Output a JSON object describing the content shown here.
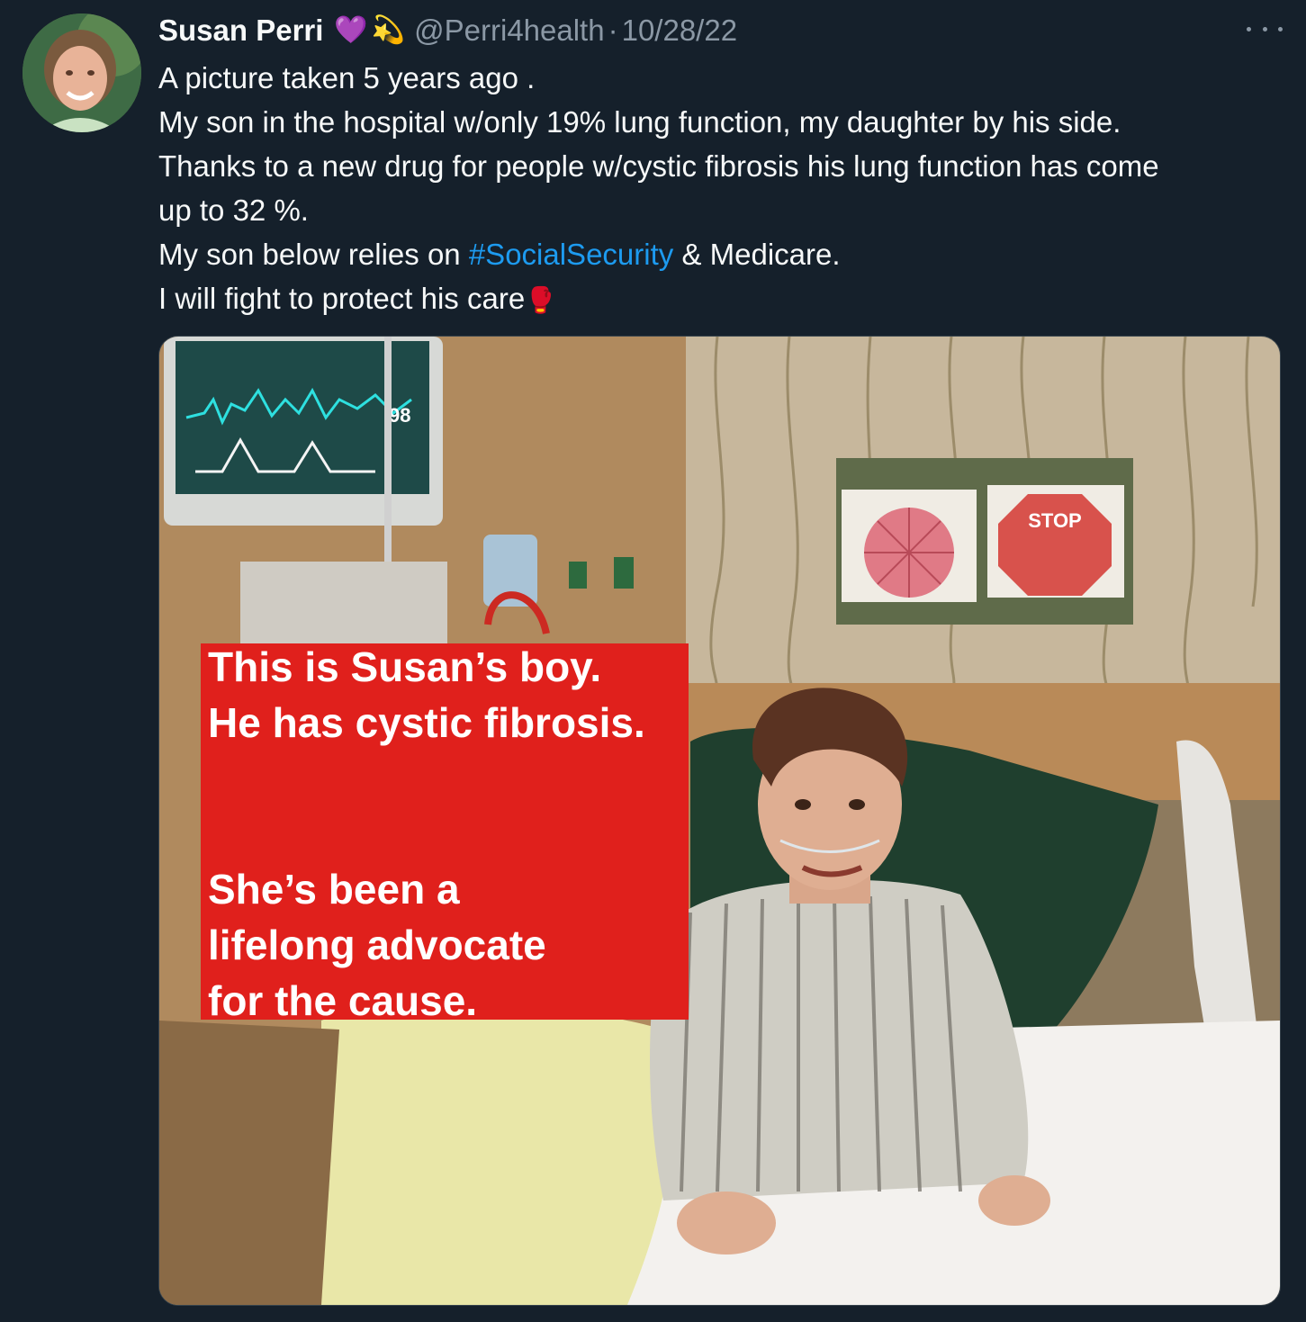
{
  "author": {
    "display_name": "Susan Perri",
    "badge_emojis": [
      "💜",
      "💫"
    ],
    "handle": "@Perri4health",
    "separator": "·",
    "date": "10/28/22"
  },
  "tweet": {
    "lines": [
      "A picture taken 5 years ago .",
      "My son in the hospital w/only 19% lung function, my daughter by his side.",
      "Thanks to a new drug for people w/cystic fibrosis his lung function has come",
      "up to 32 %."
    ],
    "line5_before": "My son below relies on ",
    "hashtag": "#SocialSecurity",
    "line5_after": " & Medicare.",
    "line6": "I will fight to protect his care",
    "line6_emoji": "🥊"
  },
  "image": {
    "overlay_lines": [
      "This is Susan’s boy.",
      "He has cystic fibrosis.",
      "She’s been a",
      "lifelong advocate",
      "for the cause."
    ],
    "monitor_reading": "98",
    "sign_text": "STOP"
  },
  "colors": {
    "background": "#15202b",
    "text": "#f7f9f9",
    "secondary": "#8b98a5",
    "link": "#1d9bf0",
    "overlay_red": "#e0201c"
  },
  "icons": {
    "more": "more-options-icon"
  }
}
